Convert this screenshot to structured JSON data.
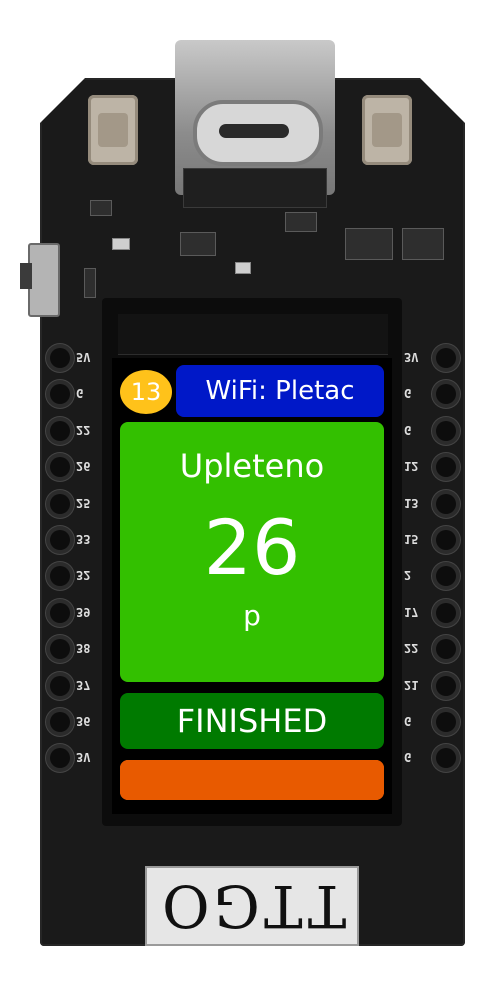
{
  "device": {
    "silkscreen_brand": "TTGO"
  },
  "screen": {
    "counter_badge": "13",
    "wifi_label": "WiFi: Pletac",
    "main_title": "Upleteno",
    "main_count": "26",
    "main_unit": "p",
    "status_text": "FINISHED",
    "progress_fraction": 1.0
  },
  "pins": {
    "left": [
      "5V",
      "G",
      "22",
      "26",
      "25",
      "33",
      "32",
      "39",
      "38",
      "37",
      "36",
      "3V"
    ],
    "right": [
      "3V",
      "G",
      "G",
      "12",
      "13",
      "15",
      "2",
      "17",
      "22",
      "21",
      "G",
      "G"
    ]
  },
  "colors": {
    "badge": "#ffc21a",
    "wifi_bar": "#0018c8",
    "main_panel": "#33c000",
    "status_bar": "#007a00",
    "progress": "#e85a00"
  }
}
